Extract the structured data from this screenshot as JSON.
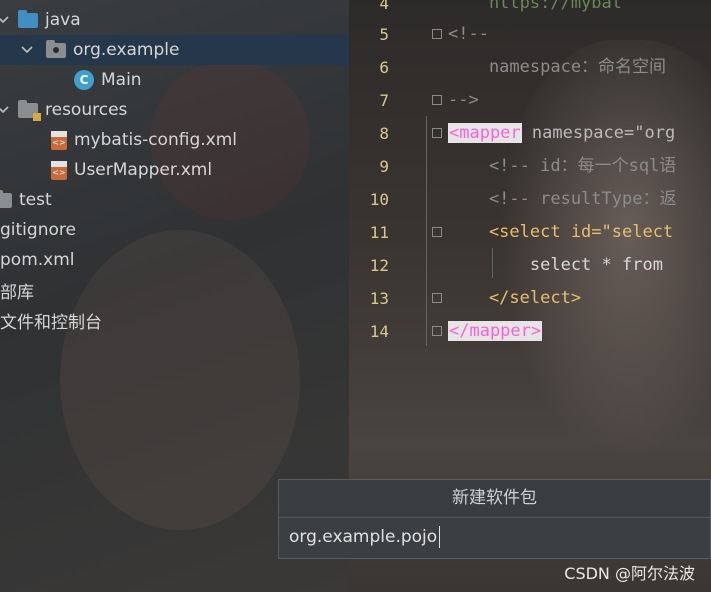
{
  "project_tree": {
    "items": [
      {
        "label": "java",
        "icon": "folder-icon",
        "expanded": true
      },
      {
        "label": "org.example",
        "icon": "package-icon",
        "expanded": true,
        "selected": true
      },
      {
        "label": "Main",
        "icon": "java-class-icon"
      },
      {
        "label": "resources",
        "icon": "resources-folder-icon",
        "expanded": true
      },
      {
        "label": "mybatis-config.xml",
        "icon": "xml-file-icon"
      },
      {
        "label": "UserMapper.xml",
        "icon": "xml-file-icon"
      },
      {
        "label": "test",
        "icon": "folder-icon"
      },
      {
        "label": "gitignore",
        "icon": "file-icon"
      },
      {
        "label": "pom.xml",
        "icon": "file-icon"
      },
      {
        "label": "部库"
      },
      {
        "label": "文件和控制台"
      }
    ]
  },
  "editor": {
    "lines": [
      {
        "num": "4",
        "text": "    https://mybat"
      },
      {
        "num": "5",
        "text": "<!--"
      },
      {
        "num": "6",
        "text": "    namespace：命名空间"
      },
      {
        "num": "7",
        "text": "-->"
      },
      {
        "num": "8",
        "tag": "<mapper",
        "rest": " namespace=\"org"
      },
      {
        "num": "9",
        "text": "    <!-- id：每一个sql语"
      },
      {
        "num": "10",
        "text": "    <!-- resultType：返"
      },
      {
        "num": "11",
        "text": "    <select id=\"select"
      },
      {
        "num": "12",
        "text": "        select * from"
      },
      {
        "num": "13",
        "text": "    </select>"
      },
      {
        "num": "14",
        "tag": "</mapper>"
      }
    ]
  },
  "dialog": {
    "title": "新建软件包",
    "input_value": "org.example.pojo"
  },
  "watermark": "CSDN @阿尔法波",
  "colors": {
    "selection": "#25374a",
    "tag_highlight": "#ff5fd6",
    "line_number": "#d8c98a"
  }
}
